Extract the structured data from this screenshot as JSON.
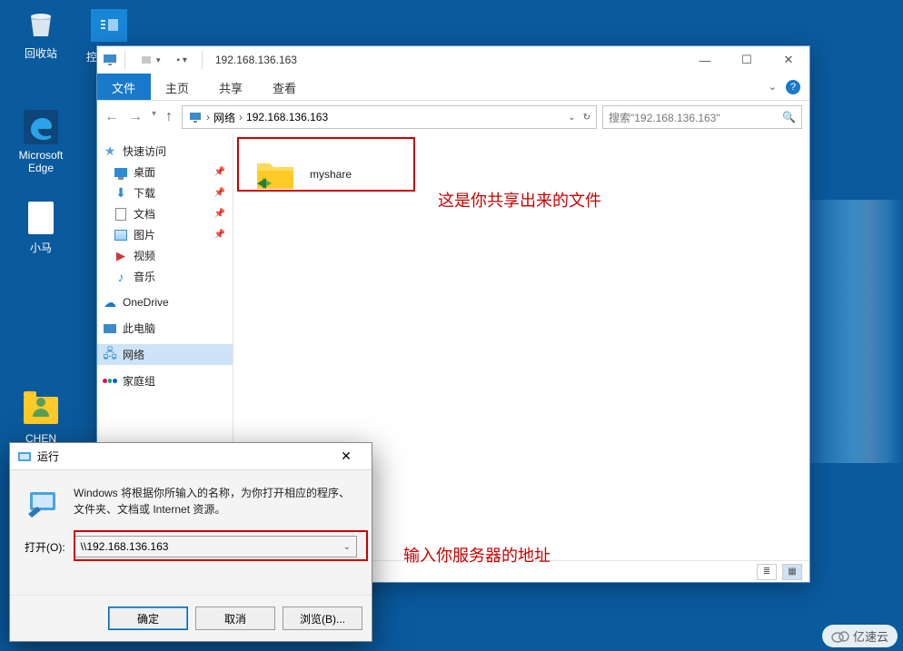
{
  "desktop": {
    "recycle": "回收站",
    "edge": "Microsoft\nEdge",
    "xiaoma": "小马",
    "chen": "CHEN",
    "control_panel_trunc": "控"
  },
  "explorer": {
    "title": "192.168.136.163",
    "tabs": {
      "file": "文件",
      "home": "主页",
      "share": "共享",
      "view": "查看"
    },
    "breadcrumb": {
      "network": "网络",
      "host": "192.168.136.163"
    },
    "search_placeholder": "搜索\"192.168.136.163\"",
    "sidebar": {
      "quick": "快速访问",
      "desktop": "桌面",
      "downloads": "下载",
      "documents": "文档",
      "pictures": "图片",
      "videos": "视频",
      "music": "音乐",
      "onedrive": "OneDrive",
      "thispc": "此电脑",
      "network": "网络",
      "homegroup": "家庭组"
    },
    "share_item": "myshare"
  },
  "annotations": {
    "shared_file": "这是你共享出来的文件",
    "enter_server": "输入你服务器的地址"
  },
  "run": {
    "title": "运行",
    "description": "Windows 将根据你所输入的名称，为你打开相应的程序、文件夹、文档或 Internet 资源。",
    "open_label": "打开(O):",
    "value": "\\\\192.168.136.163",
    "ok": "确定",
    "cancel": "取消",
    "browse": "浏览(B)..."
  },
  "watermark": "亿速云"
}
